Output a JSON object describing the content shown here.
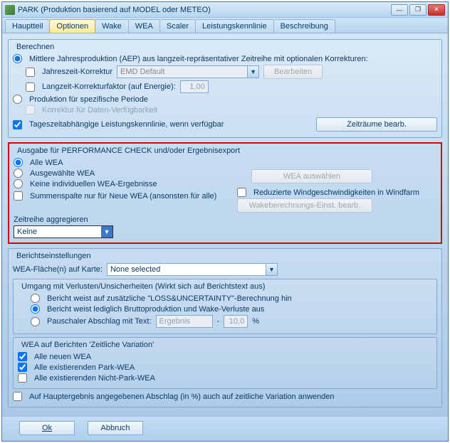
{
  "window": {
    "title": "PARK (Produktion basierend auf MODEL oder METEO)"
  },
  "tabs": [
    "Hauptteil",
    "Optionen",
    "Wake",
    "WEA",
    "Scaler",
    "Leistungskennlinie",
    "Beschreibung"
  ],
  "activeTab": 1,
  "berechnen": {
    "legend": "Berechnen",
    "opt_aep": "Mittlere Jahresproduktion (AEP) aus langzeit-repräsentativer Zeitreihe mit optionalen Korrekturen:",
    "chk_jahreszeit": "Jahreszeit-Korrektur",
    "jahreszeit_val": "EMD Default",
    "btn_bearb": "Bearbeiten",
    "chk_langzeit": "Langzeit-Korrekturfaktor (auf Energie):",
    "langzeit_val": "1,00",
    "opt_spezifisch": "Produktion für spezifische Periode",
    "chk_verfuegbar": "Korrektur für Daten-Verfügbarkeit",
    "chk_tageszeit": "Tageszeitabhängige Leistungskennlinie, wenn verfügbar",
    "btn_zeitraeume": "Zeiträume bearb."
  },
  "ausgabe": {
    "legend": "Ausgabe für PERFORMANCE CHECK und/oder Ergebnisexport",
    "opt_alle": "Alle WEA",
    "opt_ausgew": "Ausgewählte WEA",
    "opt_keine": "Keine individuellen WEA-Ergebnisse",
    "chk_summen": "Summenspalte nur für Neue WEA (ansonsten für alle)",
    "btn_wea": "WEA auswählen",
    "chk_reduzierte": "Reduzierte Windgeschwindigkeiten in Windfarm",
    "btn_wake": "Wakeberechnungs-Einst. bearb.",
    "lbl_agg": "Zeitreihe aggregieren",
    "agg_val": "Keine"
  },
  "bericht": {
    "legend": "Berichtseinstellungen",
    "lbl_flaeche": "WEA-Fläche(n) auf Karte:",
    "flaeche_val": "None selected",
    "grp_verluste": "Umgang mit Verlusten/Unsicherheiten (Wirkt sich auf Berichtstext aus)",
    "opt_loss": "Bericht weist auf zusätzliche \"LOSS&UNCERTAINTY\"-Berechnung hin",
    "opt_brutto": "Bericht weist lediglich Bruttoproduktion und Wake-Verluste aus",
    "opt_pauschal": "Pauschaler Abschlag mit Text:",
    "pauschal_text": "Ergebnis",
    "pauschal_dash": "-",
    "pauschal_val": "10,0",
    "pauschal_pct": "%",
    "grp_zeitvar": "WEA auf Berichten 'Zeitliche Variation'",
    "chk_neue": "Alle neuen WEA",
    "chk_exist_park": "Alle existierenden Park-WEA",
    "chk_exist_nichtpark": "Alle existierenden Nicht-Park-WEA",
    "chk_haupt": "Auf Hauptergebnis angegebenen Abschlag (in %) auch auf zeitliche Variation anwenden"
  },
  "footer": {
    "ok": "Ok",
    "cancel": "Abbruch"
  }
}
